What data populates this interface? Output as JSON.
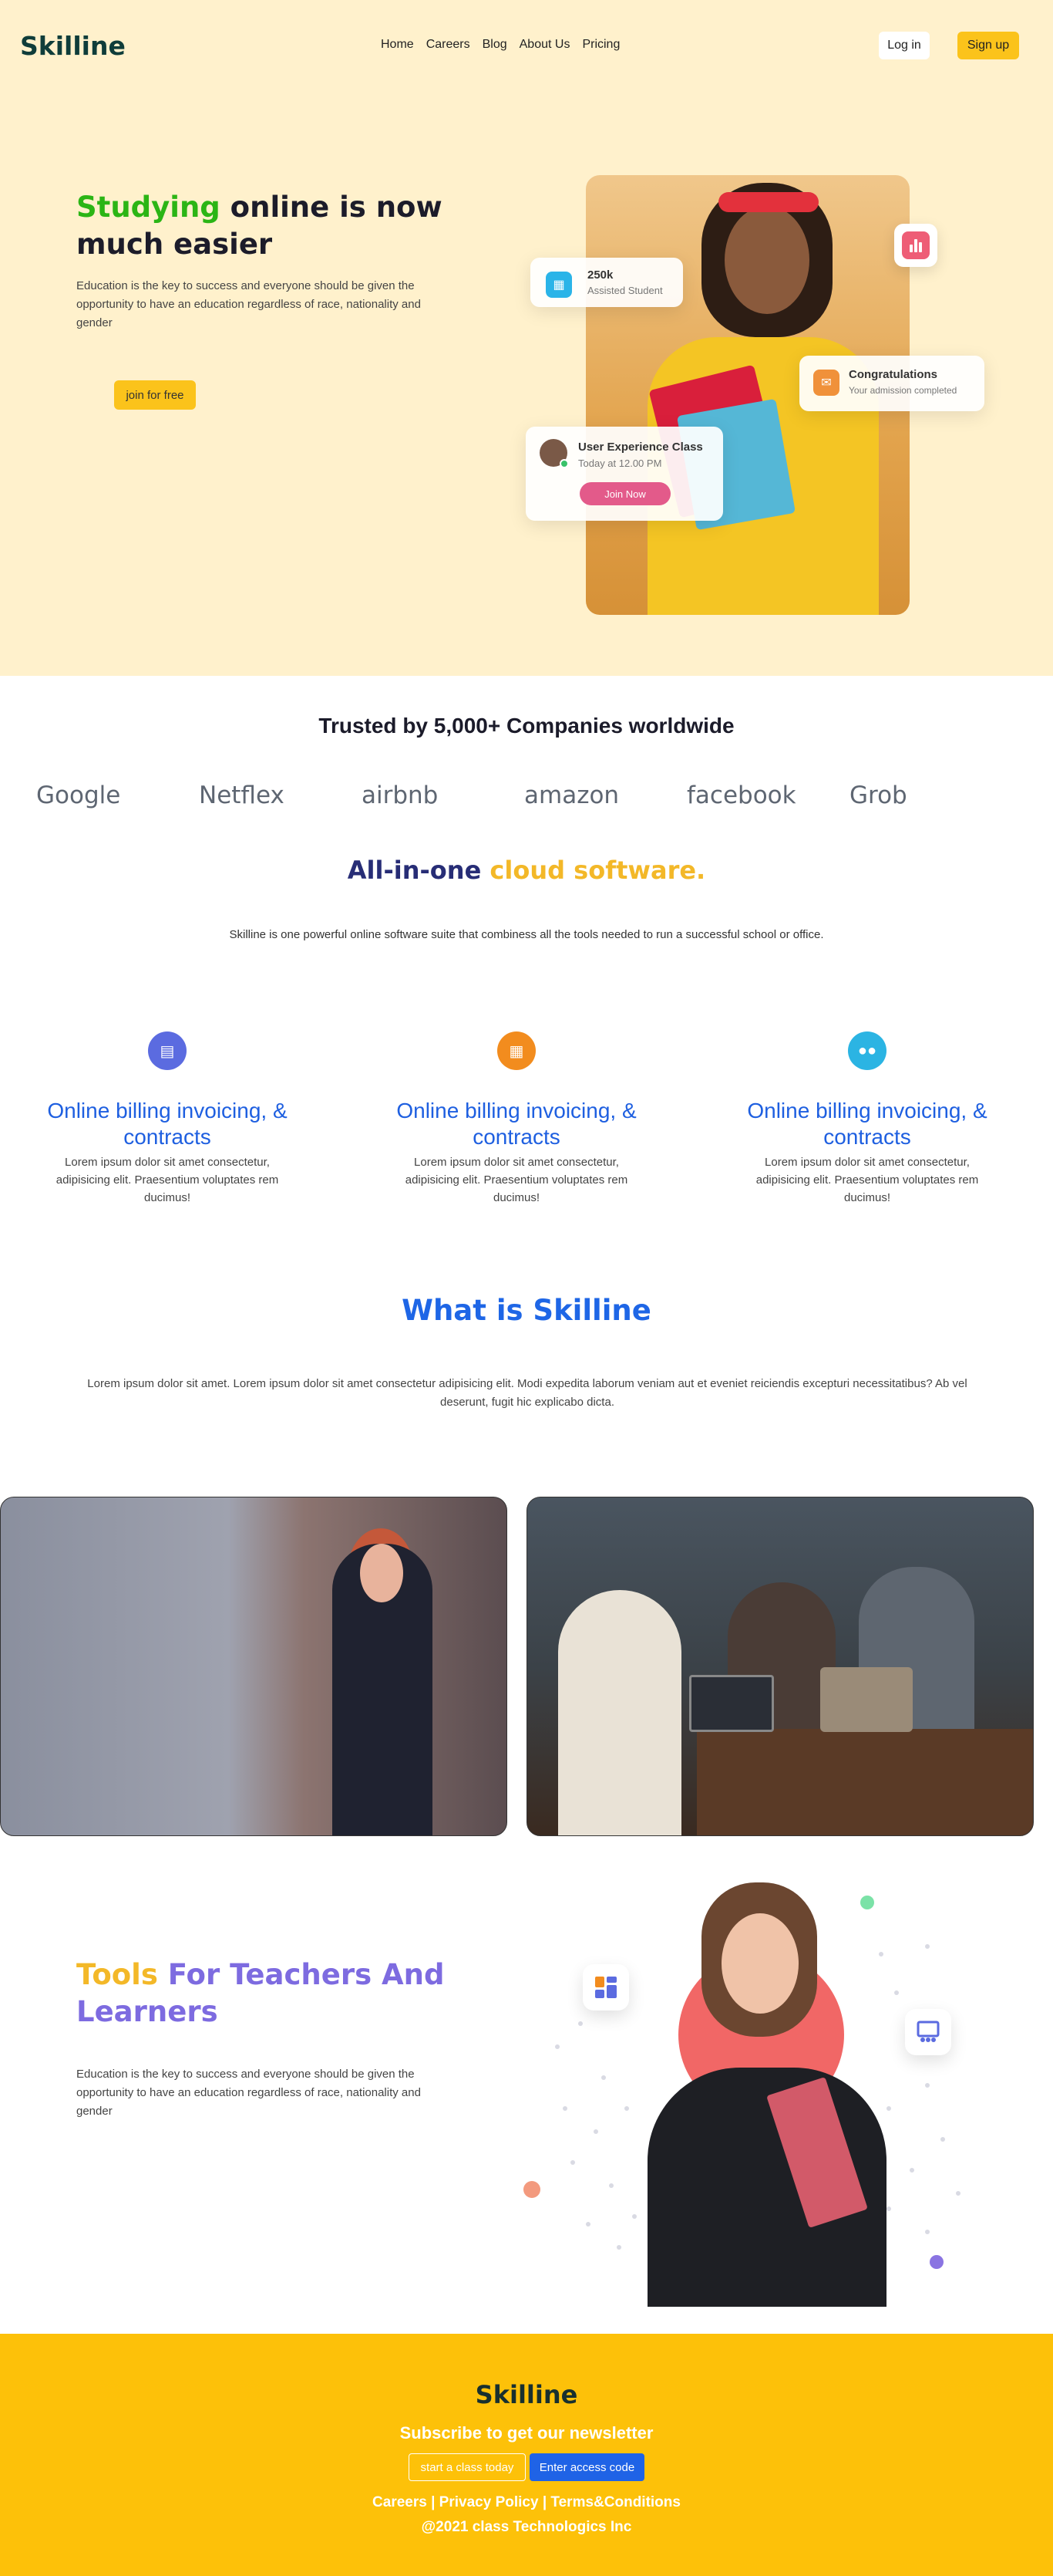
{
  "header": {
    "logo": "Skilline",
    "nav": [
      "Home",
      "Careers",
      "Blog",
      "About Us",
      "Pricing"
    ],
    "login_label": "Log in",
    "signup_label": "Sign up"
  },
  "hero": {
    "title_highlight": "Studying",
    "title_rest": " online is now much easier",
    "description": "Education is the key to success and everyone should be given the opportunity to have an education regardless of race, nationality and gender",
    "cta_label": "join for free",
    "card_students": {
      "value": "250k",
      "label": "Assisted Student",
      "icon": "calendar-icon"
    },
    "card_congrats": {
      "title": "Congratulations",
      "subtitle": "Your admission completed",
      "icon": "mail-icon"
    },
    "card_class": {
      "title": "User Experience Class",
      "time": "Today at 12.00 PM",
      "button": "Join Now"
    },
    "chart_icon": "bar-chart-icon"
  },
  "trusted": {
    "title": "Trusted by 5,000+ Companies worldwide",
    "brands": [
      "Google",
      "Netflex",
      "airbnb",
      "amazon",
      "facebook",
      "Grob"
    ]
  },
  "all_in_one": {
    "title_a": "All-in-one",
    "title_b": " cloud software.",
    "description": "Skilline is one powerful online software suite that combiness all the tools needed to run a successful school or office."
  },
  "features": [
    {
      "icon": "document-icon",
      "color": "#5b6be0",
      "title": "Online billing invoicing, & contracts",
      "description": "Lorem ipsum dolor sit amet consectetur, adipisicing elit. Praesentium voluptates rem ducimus!"
    },
    {
      "icon": "calendar-icon",
      "color": "#f28c1e",
      "title": "Online billing invoicing, & contracts",
      "description": "Lorem ipsum dolor sit amet consectetur, adipisicing elit. Praesentium voluptates rem ducimus!"
    },
    {
      "icon": "users-icon",
      "color": "#2bb4e3",
      "title": "Online billing invoicing, & contracts",
      "description": "Lorem ipsum dolor sit amet consectetur, adipisicing elit. Praesentium voluptates rem ducimus!"
    }
  ],
  "what": {
    "title": "What is Skilline",
    "description": "Lorem ipsum dolor sit amet. Lorem ipsum dolor sit amet consectetur adipisicing elit. Modi expedita laborum veniam aut et eveniet reiciendis excepturi necessitatibus? Ab vel deserunt, fugit hic explicabo dicta."
  },
  "tools": {
    "title_a": "Tools",
    "title_b": " For Teachers And Learners",
    "description": "Education is the key to success and everyone should be given the opportunity to have an education regardless of race, nationality and gender"
  },
  "footer": {
    "logo": "Skilline",
    "subscribe": "Subscribe to get our newsletter",
    "btn_start": "start a class today",
    "btn_access": "Enter access code",
    "links": "Careers | Privacy Policy | Terms&Conditions",
    "copyright": "@2021 class Technologics Inc"
  },
  "colors": {
    "accent": "#fbc31b",
    "hero_bg": "#fff1cc",
    "primary_blue": "#1e66e6",
    "purple": "#7d6be0",
    "green": "#2bb515"
  }
}
